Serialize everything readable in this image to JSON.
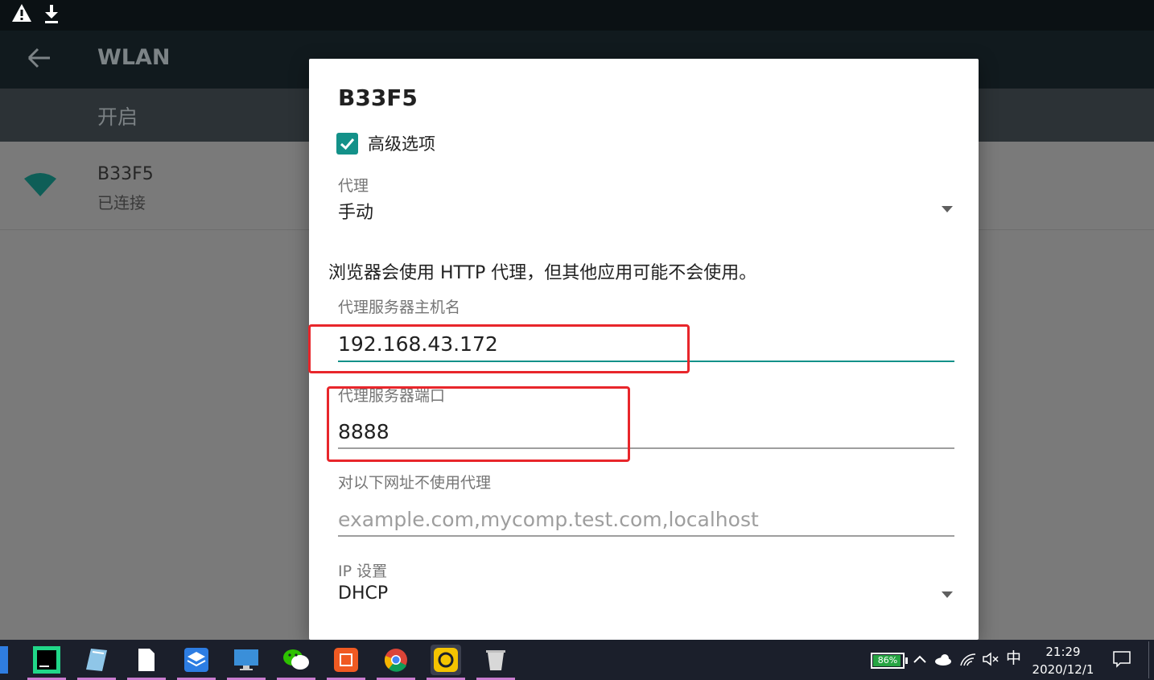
{
  "status_bar": {
    "icons": [
      "warning-icon",
      "download-icon"
    ]
  },
  "app_bar": {
    "title": "WLAN"
  },
  "switch_bar": {
    "label": "开启"
  },
  "network": {
    "ssid": "B33F5",
    "status": "已连接"
  },
  "dialog": {
    "title": "B33F5",
    "advanced_label": "高级选项",
    "advanced_checked": true,
    "proxy": {
      "label": "代理",
      "value": "手动"
    },
    "note": "浏览器会使用 HTTP 代理，但其他应用可能不会使用。",
    "host": {
      "label": "代理服务器主机名",
      "value": "192.168.43.172"
    },
    "port": {
      "label": "代理服务器端口",
      "value": "8888"
    },
    "bypass": {
      "label": "对以下网址不使用代理",
      "placeholder": "example.com,mycomp.test.com,localhost"
    },
    "ip_settings": {
      "label": "IP 设置",
      "value": "DHCP"
    }
  },
  "taskbar": {
    "apps": [
      "pycharm-icon",
      "notepad-icon",
      "file-icon",
      "layers-app-icon",
      "monitor-icon",
      "wechat-icon",
      "orange-app-icon",
      "chrome-icon",
      "yellow-app-icon",
      "recycle-icon"
    ],
    "battery": "86%",
    "ime": "中",
    "time": "21:29",
    "date": "2020/12/1"
  },
  "colors": {
    "accent": "#139189",
    "highlight": "#e8262b",
    "battery_fill": "#27a543"
  }
}
